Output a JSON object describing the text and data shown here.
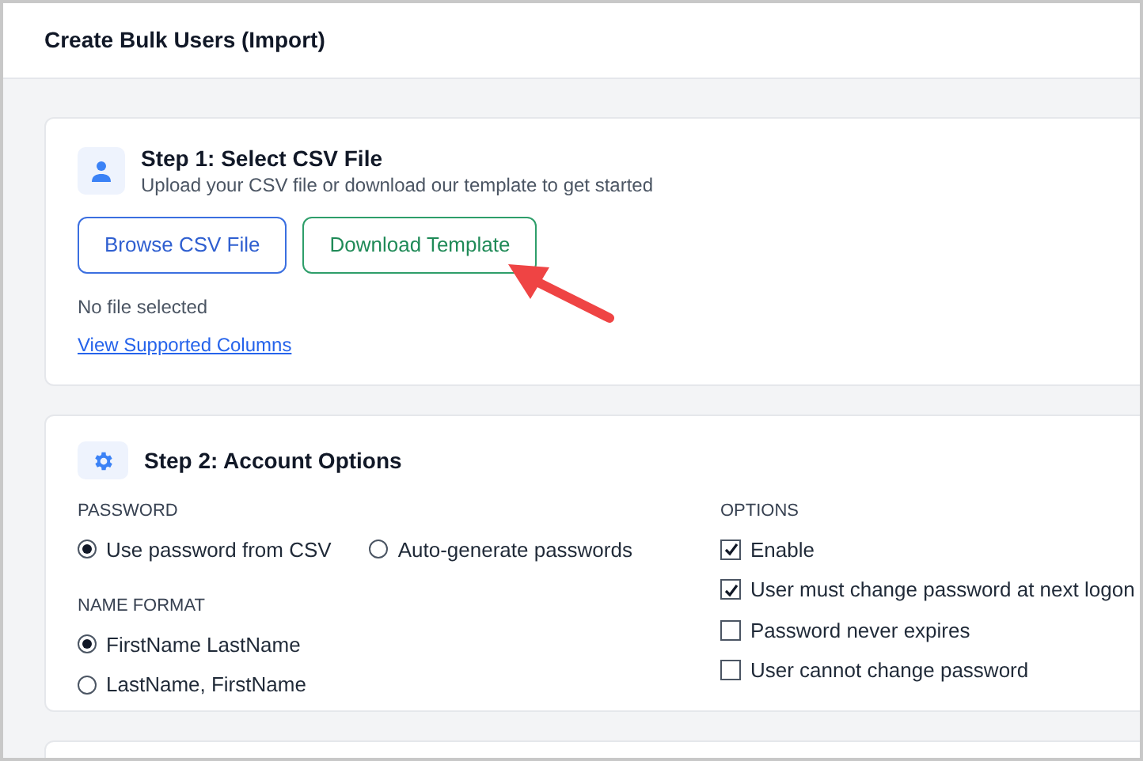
{
  "header": {
    "title": "Create Bulk Users (Import)"
  },
  "step1": {
    "title": "Step 1: Select CSV File",
    "subtitle": "Upload your CSV file or download our template to get started",
    "buttons": [
      {
        "label": "Browse CSV File",
        "kind": "primary"
      },
      {
        "label": "Download Template",
        "kind": "success"
      }
    ],
    "file_status": "No file selected",
    "link": "View Supported Columns"
  },
  "step2": {
    "title": "Step 2: Account Options",
    "password": {
      "label": "PASSWORD",
      "options": [
        {
          "label": "Use password from CSV",
          "selected": true
        },
        {
          "label": "Auto-generate passwords",
          "selected": false
        }
      ]
    },
    "name_format": {
      "label": "NAME FORMAT",
      "options": [
        {
          "label": "FirstName LastName",
          "selected": true
        },
        {
          "label": "LastName, FirstName",
          "selected": false
        }
      ]
    },
    "options": {
      "label": "OPTIONS",
      "items": [
        {
          "label": "Enable",
          "checked": true
        },
        {
          "label": "User must change password at next logon",
          "checked": true
        },
        {
          "label": "Password never expires",
          "checked": false
        },
        {
          "label": "User cannot change password",
          "checked": false
        }
      ]
    }
  }
}
